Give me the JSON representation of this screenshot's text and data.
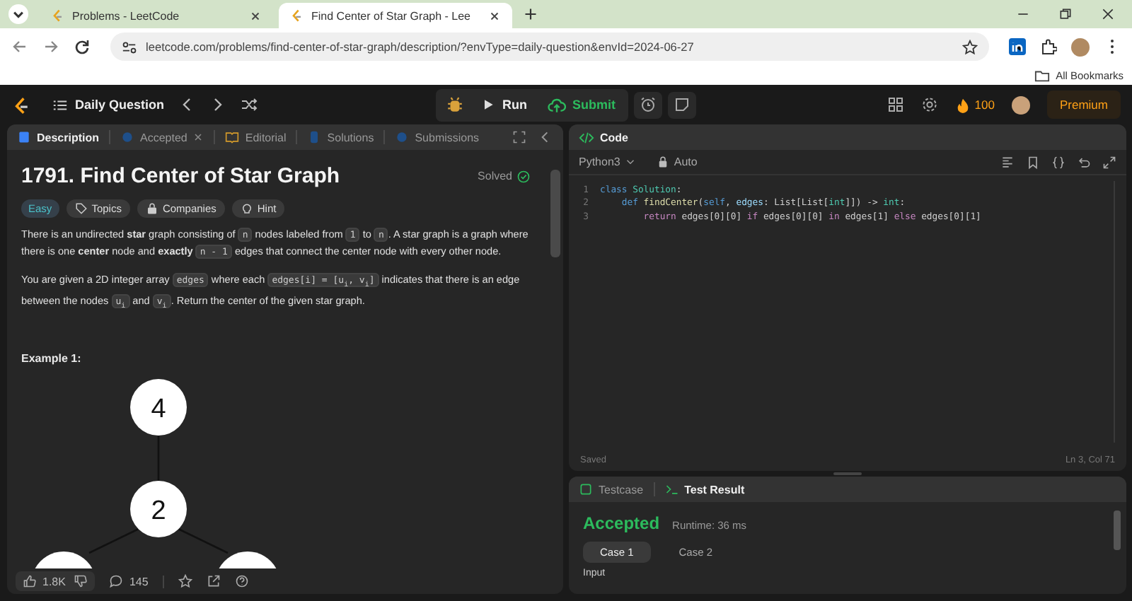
{
  "browser": {
    "tabs": [
      {
        "title": "Problems - LeetCode",
        "selected": false
      },
      {
        "title": "Find Center of Star Graph - Lee",
        "selected": true
      }
    ],
    "url": "leetcode.com/problems/find-center-of-star-graph/description/?envType=daily-question&envId=2024-06-27",
    "bookmarks": "All Bookmarks"
  },
  "navbar": {
    "title": "Daily Question",
    "run": "Run",
    "submit": "Submit",
    "streak": "100",
    "premium": "Premium"
  },
  "description_panel": {
    "tabs": [
      {
        "label": "Description",
        "selected": true,
        "closable": false
      },
      {
        "label": "Accepted",
        "selected": false,
        "closable": true
      },
      {
        "label": "Editorial",
        "selected": false,
        "closable": false
      },
      {
        "label": "Solutions",
        "selected": false,
        "closable": false
      },
      {
        "label": "Submissions",
        "selected": false,
        "closable": false
      }
    ],
    "title": "1791. Find Center of Star Graph",
    "status": "Solved",
    "tags": [
      {
        "label": "Easy",
        "kind": "difficulty"
      },
      {
        "label": "Topics",
        "kind": "topics"
      },
      {
        "label": "Companies",
        "kind": "companies"
      },
      {
        "label": "Hint",
        "kind": "hint"
      }
    ],
    "paragraphs": [
      [
        {
          "kind": "text",
          "text": "There is an undirected "
        },
        {
          "kind": "bold",
          "text": "star"
        },
        {
          "kind": "text",
          "text": " graph consisting of "
        },
        {
          "kind": "code",
          "text": "n"
        },
        {
          "kind": "text",
          "text": " nodes labeled from "
        },
        {
          "kind": "code",
          "text": "1"
        },
        {
          "kind": "text",
          "text": " to "
        },
        {
          "kind": "code",
          "text": "n"
        },
        {
          "kind": "text",
          "text": ". A star graph is a graph where there is one "
        },
        {
          "kind": "bold",
          "text": "center"
        },
        {
          "kind": "text",
          "text": " node and "
        },
        {
          "kind": "bold",
          "text": "exactly "
        },
        {
          "kind": "code",
          "text": "n - 1"
        },
        {
          "kind": "text",
          "text": " edges that connect the center node with every other node."
        }
      ],
      [
        {
          "kind": "text",
          "text": "You are given a 2D integer array "
        },
        {
          "kind": "code",
          "text": "edges"
        },
        {
          "kind": "text",
          "text": " where each "
        },
        {
          "kind": "code",
          "text": "edges[i] = [u$_{i}$, v$_{i}$]"
        },
        {
          "kind": "text",
          "text": " indicates that there is an edge between the nodes "
        },
        {
          "kind": "code",
          "text": "u$_{i}$"
        },
        {
          "kind": "text",
          "text": " and "
        },
        {
          "kind": "code",
          "text": "v$_{i}$"
        },
        {
          "kind": "text",
          "text": ". Return the center of the given star graph."
        }
      ]
    ],
    "example_heading": "Example 1:",
    "graph_nodes": [
      {
        "label": "4"
      },
      {
        "label": "2"
      }
    ],
    "likes": "1.8K",
    "comments": "145"
  },
  "code_panel": {
    "title": "Code",
    "language": "Python3",
    "mode": "Auto",
    "lines": [
      {
        "number": "1",
        "tokens": [
          {
            "kind": "keyword",
            "text": "class "
          },
          {
            "kind": "type",
            "text": "Solution"
          },
          {
            "kind": "plain",
            "text": ":"
          }
        ]
      },
      {
        "number": "2",
        "tokens": [
          {
            "kind": "keyword",
            "text": "    def "
          },
          {
            "kind": "function",
            "text": "findCenter"
          },
          {
            "kind": "plain",
            "text": "("
          },
          {
            "kind": "keyword",
            "text": "self"
          },
          {
            "kind": "plain",
            "text": ", "
          },
          {
            "kind": "param",
            "text": "edges"
          },
          {
            "kind": "plain",
            "text": ": List["
          },
          {
            "kind": "plain",
            "text": "List["
          },
          {
            "kind": "type",
            "text": "int"
          },
          {
            "kind": "plain",
            "text": "]]) -> "
          },
          {
            "kind": "type",
            "text": "int"
          },
          {
            "kind": "plain",
            "text": ":"
          }
        ]
      },
      {
        "number": "3",
        "tokens": [
          {
            "kind": "control",
            "text": "        return"
          },
          {
            "kind": "plain",
            "text": " edges[0][0] "
          },
          {
            "kind": "control",
            "text": "if"
          },
          {
            "kind": "plain",
            "text": " edges[0][0] "
          },
          {
            "kind": "control",
            "text": "in"
          },
          {
            "kind": "plain",
            "text": " edges[1] "
          },
          {
            "kind": "control",
            "text": "else"
          },
          {
            "kind": "plain",
            "text": " edges[0][1]"
          }
        ]
      }
    ],
    "save_status": "Saved",
    "cursor": "Ln 3, Col 71"
  },
  "test_panel": {
    "tabs": [
      {
        "label": "Testcase",
        "selected": false
      },
      {
        "label": "Test Result",
        "selected": true
      }
    ],
    "verdict": "Accepted",
    "runtime": "Runtime: 36 ms",
    "cases": [
      {
        "label": "Case 1",
        "selected": true
      },
      {
        "label": "Case 2",
        "selected": false
      }
    ],
    "input_label": "Input"
  }
}
